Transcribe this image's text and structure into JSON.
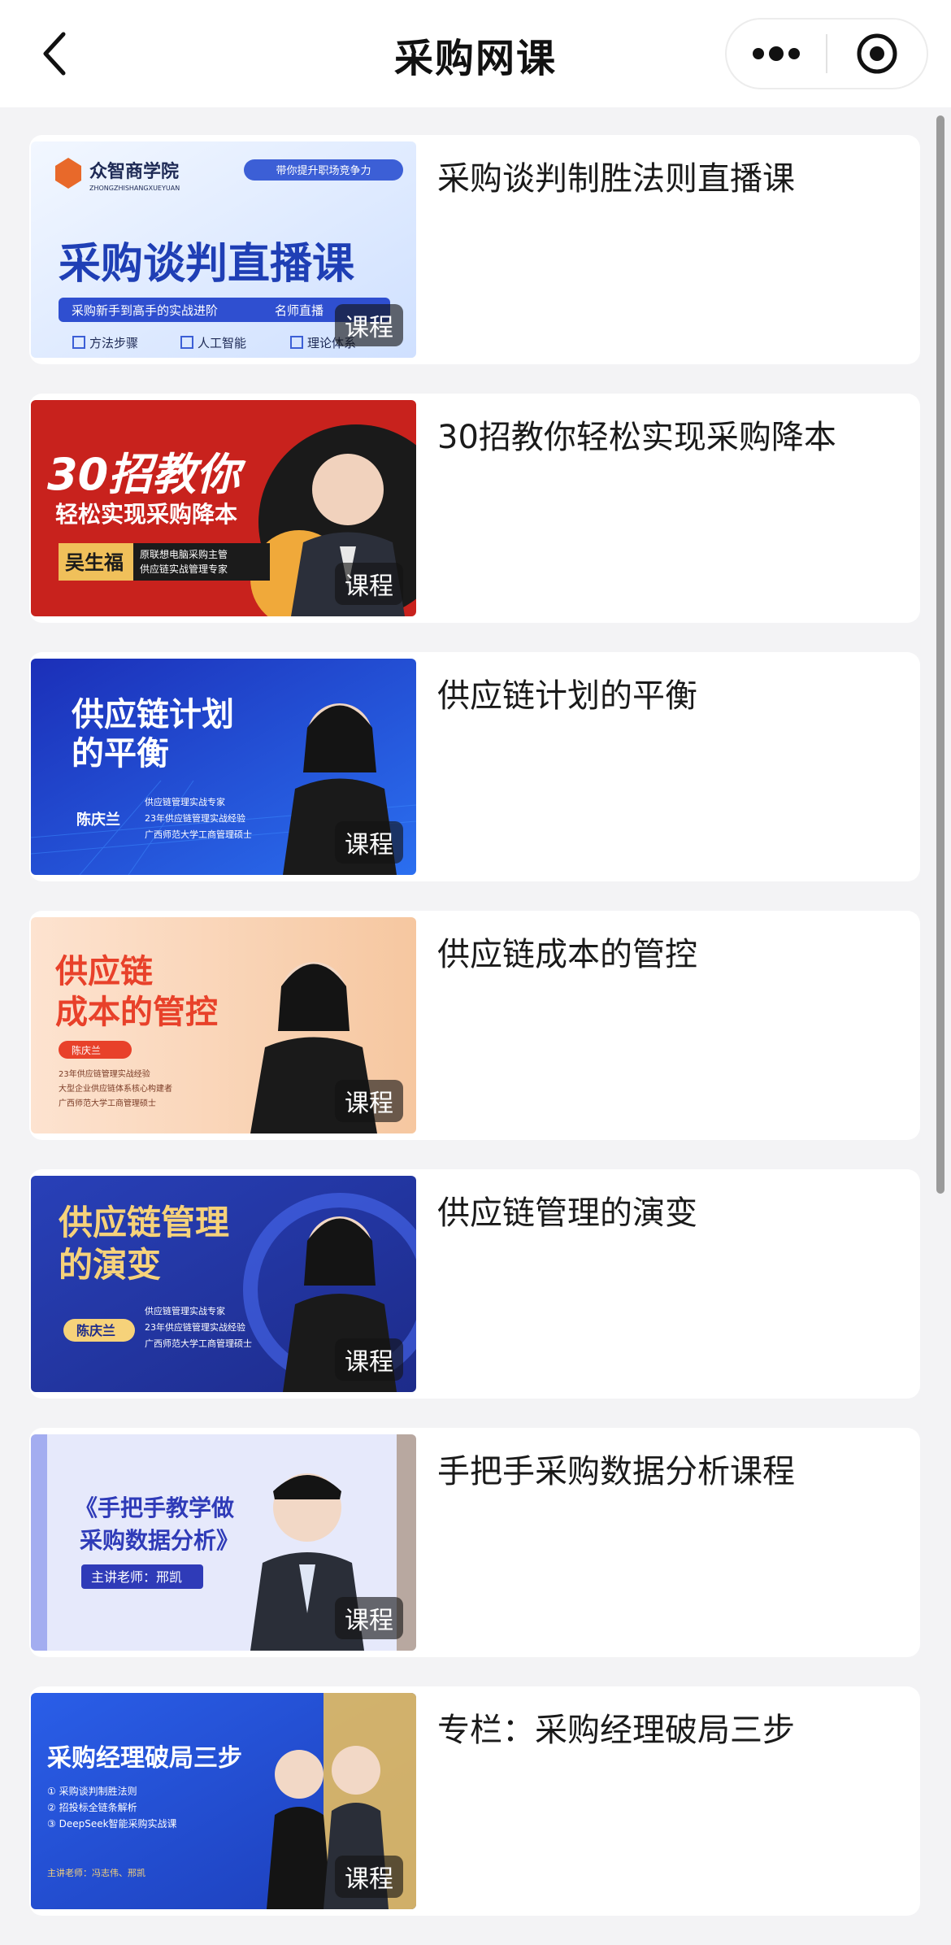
{
  "page": {
    "title": "采购网课"
  },
  "navbar": {
    "back_icon": "chevron-left-icon",
    "more_icon": "more-dots-icon",
    "close_icon": "target-circle-icon"
  },
  "course_tag": "课程",
  "courses": [
    {
      "title": "采购谈判制胜法则直播课",
      "cover": {
        "brand": "众智商学院",
        "brand_sub": "ZHONGZHISHANGXUEYUAN",
        "pill": "带你提升职场竞争力",
        "headline": "采购谈判直播课",
        "subline": "采购新手到高手的实战进阶",
        "subline2": "名师直播",
        "checks": [
          "方法步骤",
          "人工智能",
          "理论体系"
        ]
      }
    },
    {
      "title": "30招教你轻松实现采购降本",
      "cover": {
        "headline1": "30招教你",
        "headline2": "轻松实现采购降本",
        "teacher": "吴生福",
        "desc1": "原联想电脑采购主管",
        "desc2": "供应链实战管理专家"
      }
    },
    {
      "title": "供应链计划的平衡",
      "cover": {
        "headline1": "供应链计划",
        "headline2": "的平衡",
        "teacher": "陈庆兰",
        "bullets": [
          "供应链管理实战专家",
          "23年供应链管理实战经验",
          "广西师范大学工商管理硕士"
        ]
      }
    },
    {
      "title": "供应链成本的管控",
      "cover": {
        "headline1": "供应链",
        "headline2": "成本的管控",
        "teacher": "陈庆兰",
        "bullets": [
          "23年供应链管理实战经验",
          "大型企业供应链体系核心构建者",
          "广西师范大学工商管理硕士"
        ]
      }
    },
    {
      "title": "供应链管理的演变",
      "cover": {
        "headline1": "供应链管理",
        "headline2": "的演变",
        "teacher": "陈庆兰",
        "bullets": [
          "供应链管理实战专家",
          "23年供应链管理实战经验",
          "广西师范大学工商管理硕士"
        ]
      }
    },
    {
      "title": "手把手采购数据分析课程",
      "cover": {
        "headline1": "《手把手教学做",
        "headline2": "采购数据分析》",
        "teacher": "主讲老师：邢凯"
      }
    },
    {
      "title": "专栏：采购经理破局三步",
      "cover": {
        "headline": "采购经理破局三步",
        "bullets": [
          "① 采购谈判制胜法则",
          "② 招投标全链条解析",
          "③ DeepSeek智能采购实战课"
        ],
        "teacher": "主讲老师：冯志伟、邢凯"
      }
    }
  ],
  "colors": {
    "navbar_bg": "#ffffff",
    "page_bg": "#f3f3f5",
    "card_bg": "#ffffff",
    "title_text": "#1a1a1a"
  }
}
